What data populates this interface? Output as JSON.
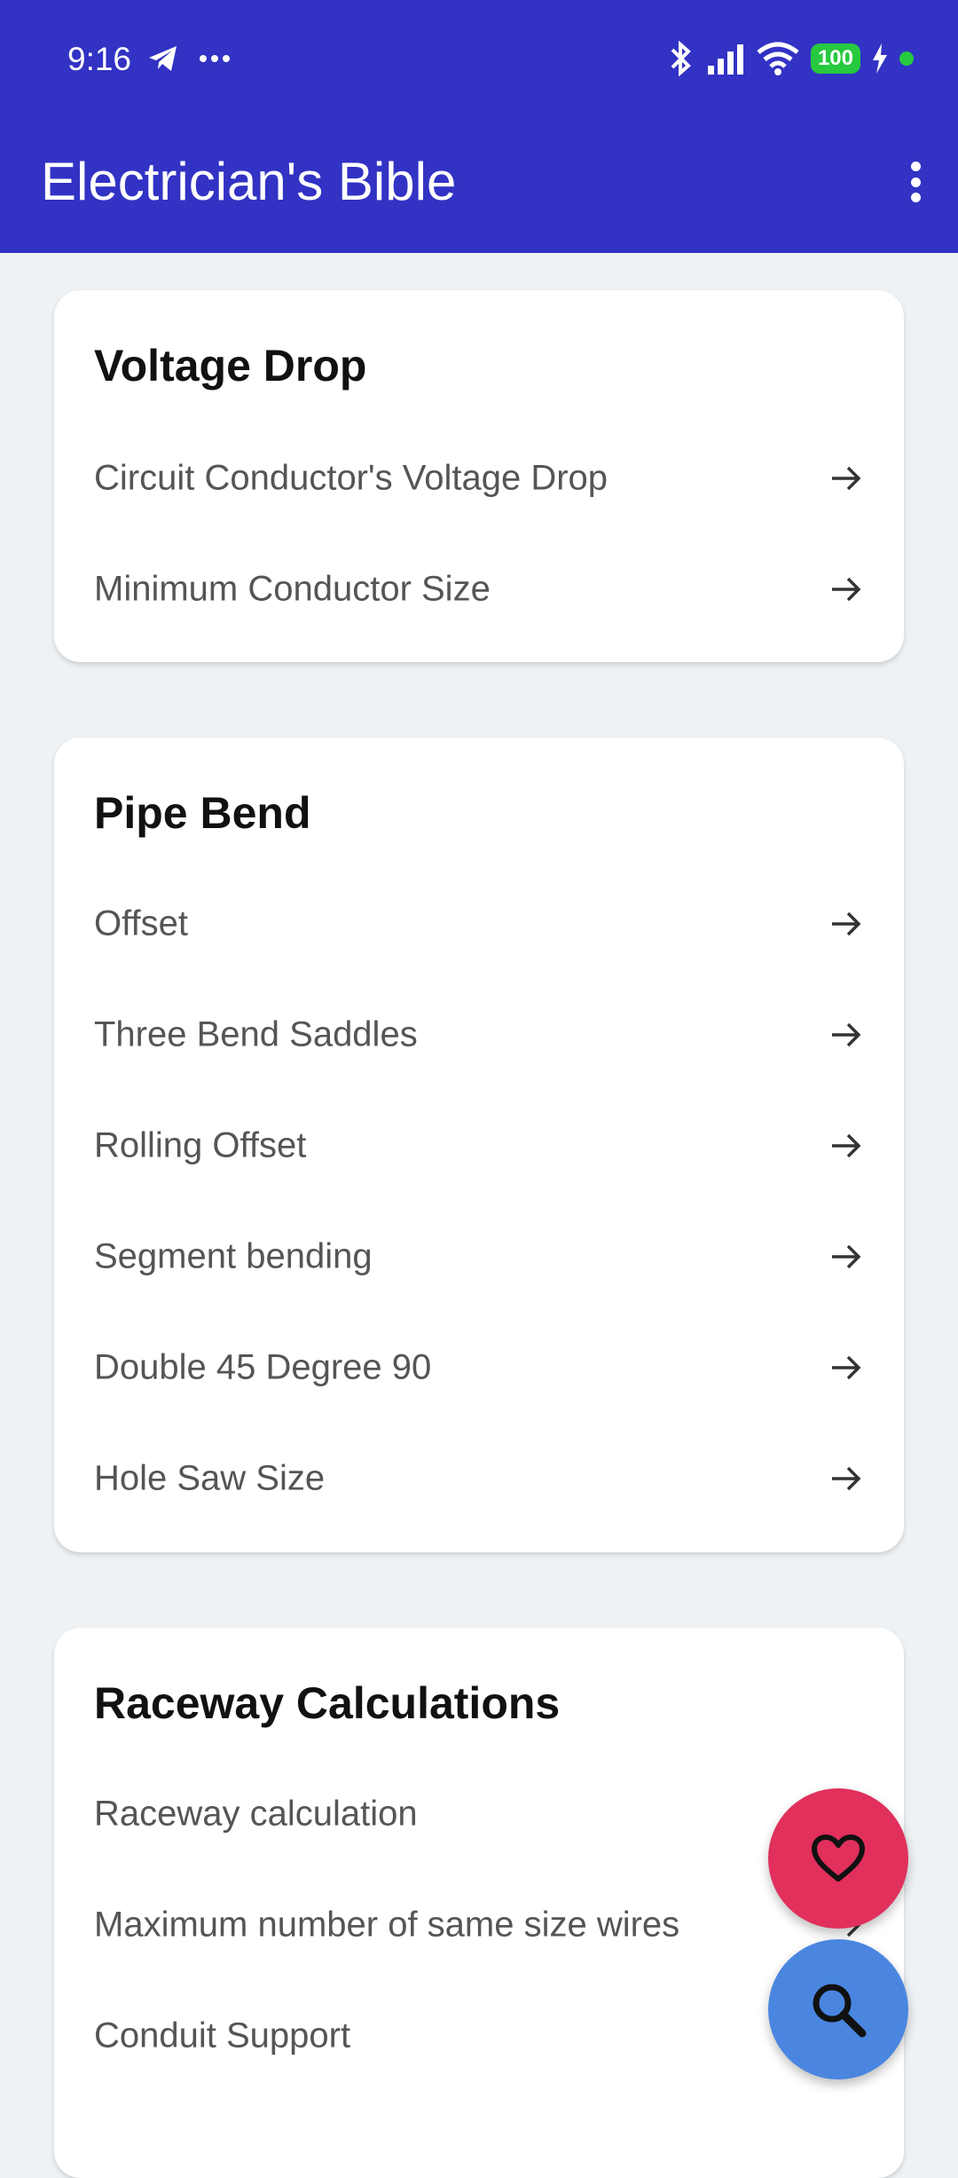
{
  "status_bar": {
    "time": "9:16",
    "battery": "100"
  },
  "app": {
    "title": "Electrician's Bible"
  },
  "sections": [
    {
      "title": "Voltage Drop",
      "items": [
        "Circuit Conductor's Voltage Drop",
        "Minimum Conductor Size"
      ]
    },
    {
      "title": "Pipe Bend",
      "items": [
        "Offset",
        "Three Bend Saddles",
        "Rolling Offset",
        "Segment bending",
        "Double 45 Degree 90",
        "Hole Saw Size"
      ]
    },
    {
      "title": "Raceway Calculations",
      "items": [
        "Raceway calculation",
        "Maximum number of same size wires",
        "Conduit Support"
      ]
    }
  ],
  "icons": {
    "row_arrow": "arrow-right-icon",
    "fab_favorite": "heart-icon",
    "fab_search": "search-icon",
    "menu": "more-vert-icon"
  },
  "colors": {
    "app_bar": "#3232c4",
    "fab_favorite": "#e0305b",
    "fab_search": "#4a86e0"
  }
}
